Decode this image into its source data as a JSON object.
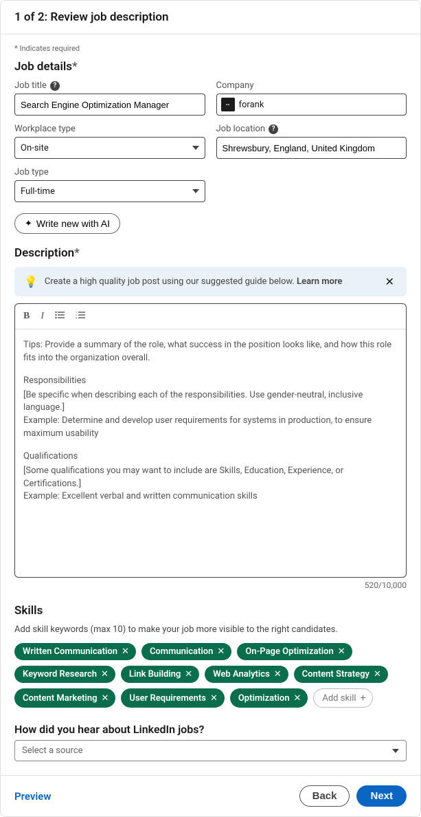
{
  "header": {
    "title": "1 of 2: Review job description"
  },
  "requiredNote": "* Indicates required",
  "sections": {
    "jobDetails": {
      "heading": "Job details",
      "fields": {
        "jobTitle": {
          "label": "Job title",
          "value": "Search Engine Optimization Manager"
        },
        "company": {
          "label": "Company",
          "value": "forank"
        },
        "workplaceType": {
          "label": "Workplace type",
          "value": "On-site"
        },
        "jobLocation": {
          "label": "Job location",
          "value": "Shrewsbury, England, United Kingdom"
        },
        "jobType": {
          "label": "Job type",
          "value": "Full-time"
        }
      },
      "aiButton": "Write new with AI"
    },
    "description": {
      "heading": "Description",
      "banner": {
        "text": "Create a high quality job post using our suggested guide below. ",
        "link": "Learn more"
      },
      "placeholder": {
        "tips": "Tips: Provide a summary of the role, what success in the position looks like, and how this role fits into the organization overall.",
        "respHead": "Responsibilities",
        "respLine1": "[Be specific when describing each of the responsibilities. Use gender-neutral, inclusive language.]",
        "respLine2": "Example: Determine and develop user requirements for systems in production, to ensure maximum usability",
        "qualHead": "Qualifications",
        "qualLine1": "[Some qualifications you may want to include are Skills, Education, Experience, or Certifications.]",
        "qualLine2": "Example: Excellent verbal and written communication skills"
      },
      "charCount": "520/10,000"
    },
    "skills": {
      "heading": "Skills",
      "help": "Add skill keywords (max 10) to make your job more visible to the right candidates.",
      "chips": [
        "Written Communication",
        "Communication",
        "On-Page Optimization",
        "Keyword Research",
        "Link Building",
        "Web Analytics",
        "Content Strategy",
        "Content Marketing",
        "User Requirements",
        "Optimization"
      ],
      "addChip": "Add skill"
    },
    "source": {
      "heading": "How did you hear about LinkedIn jobs?",
      "placeholder": "Select a source"
    }
  },
  "footer": {
    "preview": "Preview",
    "back": "Back",
    "next": "Next"
  }
}
